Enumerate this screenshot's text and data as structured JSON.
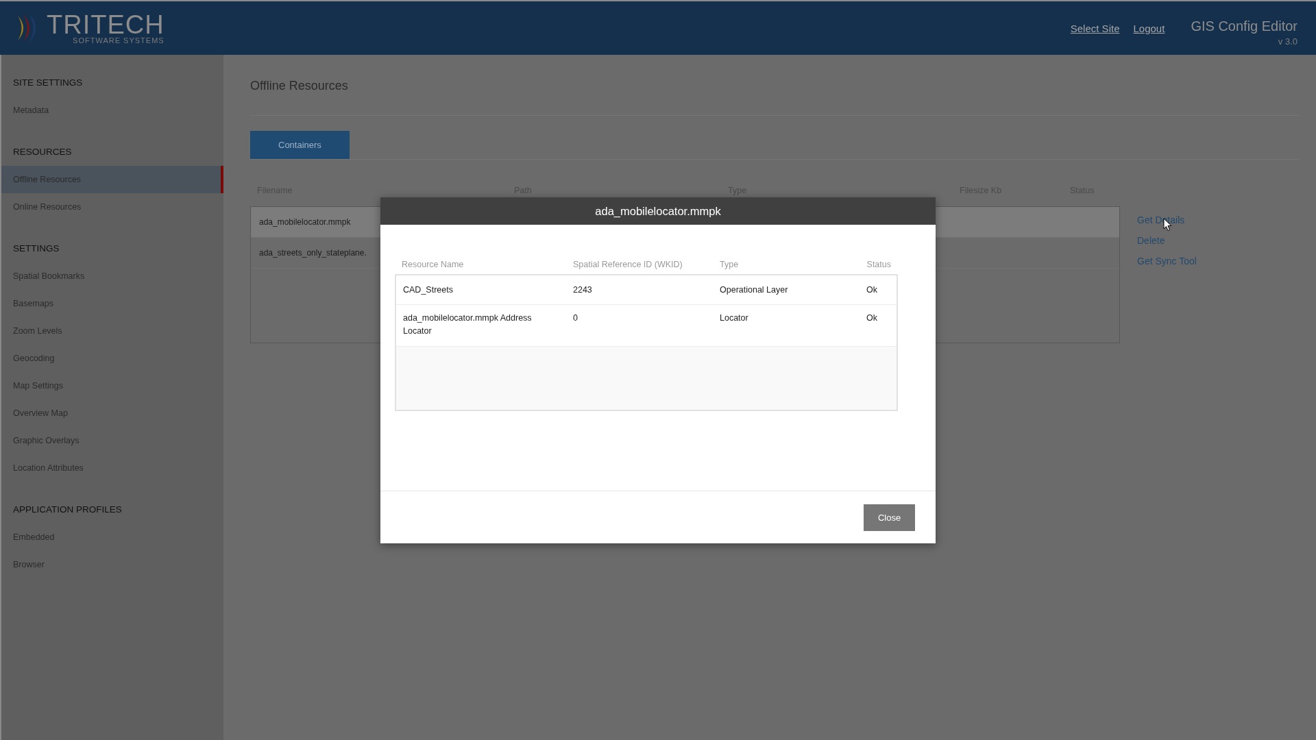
{
  "header": {
    "logo": {
      "name": "TRITECH",
      "tagline": "SOFTWARE SYSTEMS"
    },
    "links": [
      "Select Site",
      "Logout"
    ],
    "app_title": "GIS Config Editor",
    "version": "v 3.0"
  },
  "sidebar": {
    "sections": [
      {
        "heading": "SITE SETTINGS",
        "items": [
          {
            "label": "Metadata",
            "selected": false
          }
        ]
      },
      {
        "heading": "RESOURCES",
        "items": [
          {
            "label": "Offline Resources",
            "selected": true
          },
          {
            "label": "Online Resources",
            "selected": false
          }
        ]
      },
      {
        "heading": "SETTINGS",
        "items": [
          {
            "label": "Spatial Bookmarks",
            "selected": false
          },
          {
            "label": "Basemaps",
            "selected": false
          },
          {
            "label": "Zoom Levels",
            "selected": false
          },
          {
            "label": "Geocoding",
            "selected": false
          },
          {
            "label": "Map Settings",
            "selected": false
          },
          {
            "label": "Overview Map",
            "selected": false
          },
          {
            "label": "Graphic Overlays",
            "selected": false
          },
          {
            "label": "Location Attributes",
            "selected": false
          }
        ]
      },
      {
        "heading": "APPLICATION PROFILES",
        "items": [
          {
            "label": "Embedded",
            "selected": false
          },
          {
            "label": "Browser",
            "selected": false
          }
        ]
      }
    ]
  },
  "main": {
    "title": "Offline Resources",
    "tabs": [
      {
        "label": "Containers",
        "selected": true
      }
    ],
    "table": {
      "columns": [
        "Filename",
        "Path",
        "Type",
        "Filesize Kb",
        "Status"
      ],
      "rows": [
        {
          "filename": "ada_mobilelocator.mmpk",
          "highlighted": true
        },
        {
          "filename": "ada_streets_only_stateplane.",
          "highlighted": false
        }
      ]
    },
    "actions": [
      "Get Details",
      "Delete",
      "Get Sync Tool"
    ]
  },
  "modal": {
    "title": "ada_mobilelocator.mmpk",
    "columns": [
      "Resource Name",
      "Spatial Reference ID (WKID)",
      "Type",
      "Status"
    ],
    "rows": [
      [
        "CAD_Streets",
        "2243",
        "Operational Layer",
        "Ok"
      ],
      [
        "ada_mobilelocator.mmpk Address Locator",
        "0",
        "Locator",
        "Ok"
      ]
    ],
    "close_button": "Close"
  }
}
